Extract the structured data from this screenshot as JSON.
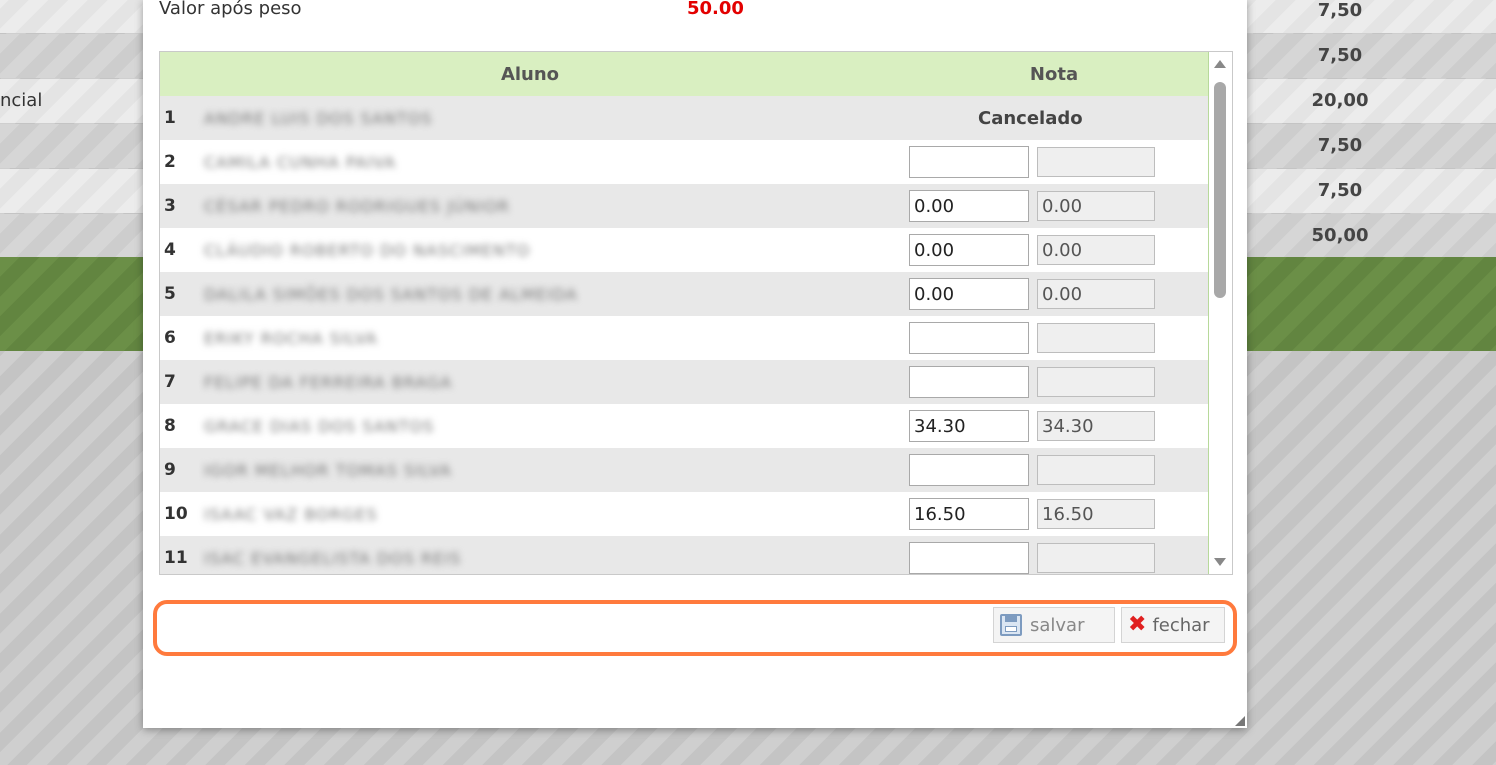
{
  "background": {
    "rows": [
      {
        "label": "",
        "value": "7,50"
      },
      {
        "label": "",
        "value": "7,50"
      },
      {
        "label": "ncial",
        "value": "20,00"
      },
      {
        "label": "",
        "value": "7,50"
      },
      {
        "label": "",
        "value": "7,50"
      },
      {
        "label": "",
        "value": "50,00"
      }
    ]
  },
  "dialog": {
    "valor_label": "Valor após peso",
    "valor_value": "50.00",
    "grid": {
      "header_aluno": "Aluno",
      "header_nota": "Nota",
      "rows": [
        {
          "num": "1",
          "name": "ANDRE LUIS DOS SANTOS",
          "status": "Cancelado",
          "nota": "",
          "nota_final": ""
        },
        {
          "num": "2",
          "name": "CAMILA CUNHA PAIVA",
          "status": "",
          "nota": "",
          "nota_final": ""
        },
        {
          "num": "3",
          "name": "CÉSAR PEDRO RODRIGUES JÚNIOR",
          "status": "",
          "nota": "0.00",
          "nota_final": "0.00"
        },
        {
          "num": "4",
          "name": "CLÁUDIO ROBERTO DO NASCIMENTO",
          "status": "",
          "nota": "0.00",
          "nota_final": "0.00"
        },
        {
          "num": "5",
          "name": "DALILA SIMÕES DOS SANTOS DE ALMEIDA",
          "status": "",
          "nota": "0.00",
          "nota_final": "0.00"
        },
        {
          "num": "6",
          "name": "ERIKY ROCHA SILVA",
          "status": "",
          "nota": "",
          "nota_final": ""
        },
        {
          "num": "7",
          "name": "FELIPE DA FERREIRA BRAGA",
          "status": "",
          "nota": "",
          "nota_final": ""
        },
        {
          "num": "8",
          "name": "GRACE DIAS DOS SANTOS",
          "status": "",
          "nota": "34.30",
          "nota_final": "34.30"
        },
        {
          "num": "9",
          "name": "IGOR MELHOR TOMAS SILVA",
          "status": "",
          "nota": "",
          "nota_final": ""
        },
        {
          "num": "10",
          "name": "ISAAC VAZ BORGES",
          "status": "",
          "nota": "16.50",
          "nota_final": "16.50"
        },
        {
          "num": "11",
          "name": "ISAC EVANGELISTA DOS REIS",
          "status": "",
          "nota": "",
          "nota_final": ""
        }
      ]
    },
    "buttons": {
      "save_label": "salvar",
      "close_label": "fechar"
    }
  },
  "colors": {
    "accent_value": "#e30000",
    "header_green": "#d9efc1",
    "highlight_orange": "#ff7a3d",
    "band_green": "#6b8f47"
  }
}
